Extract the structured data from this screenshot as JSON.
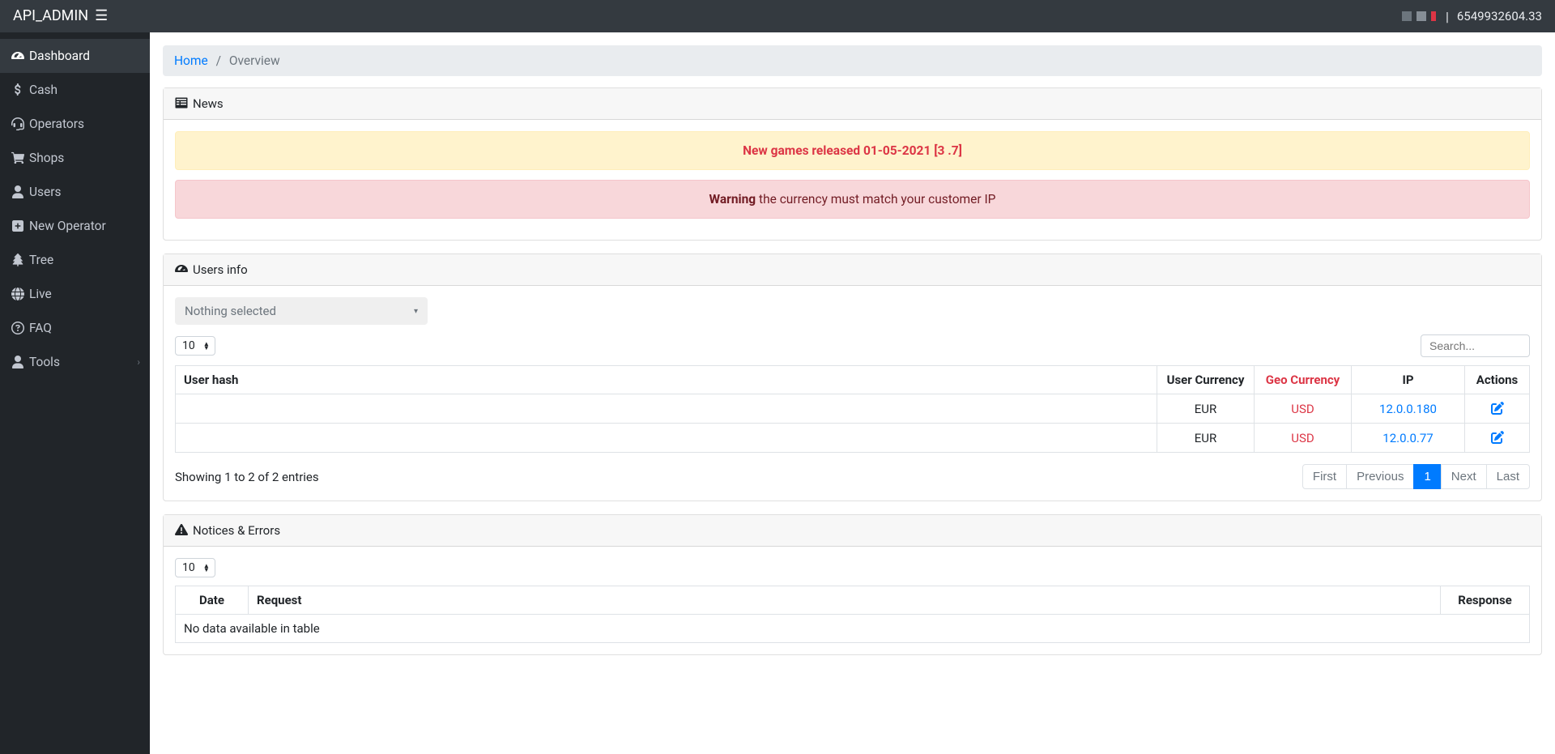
{
  "topbar": {
    "brand": "API_ADMIN",
    "balance": "6549932604.33"
  },
  "sidebar": {
    "items": [
      {
        "label": "Dashboard",
        "icon": "gauge"
      },
      {
        "label": "Cash",
        "icon": "dollar"
      },
      {
        "label": "Operators",
        "icon": "headset"
      },
      {
        "label": "Shops",
        "icon": "cart"
      },
      {
        "label": "Users",
        "icon": "user"
      },
      {
        "label": "New Operator",
        "icon": "plus-square"
      },
      {
        "label": "Tree",
        "icon": "tree"
      },
      {
        "label": "Live",
        "icon": "globe"
      },
      {
        "label": "FAQ",
        "icon": "question"
      },
      {
        "label": "Tools",
        "icon": "user"
      }
    ]
  },
  "breadcrumb": {
    "home": "Home",
    "current": "Overview"
  },
  "news": {
    "header": "News",
    "release_text": "New games released 01-05-2021 [3 .7]",
    "warning_bold": "Warning",
    "warning_rest": " the currency must match your customer IP"
  },
  "users_info": {
    "header": "Users info",
    "dropdown_placeholder": "Nothing selected",
    "length_value": "10",
    "search_placeholder": "Search...",
    "columns": {
      "user_hash": "User hash",
      "user_currency": "User Currency",
      "geo_currency": "Geo Currency",
      "ip": "IP",
      "actions": "Actions"
    },
    "rows": [
      {
        "hash": "",
        "user_currency": "EUR",
        "geo_currency": "USD",
        "ip": "12.0.0.180"
      },
      {
        "hash": "",
        "user_currency": "EUR",
        "geo_currency": "USD",
        "ip": "12.0.0.77"
      }
    ],
    "showing_text": "Showing 1 to 2 of 2 entries",
    "pagination": {
      "first": "First",
      "previous": "Previous",
      "page1": "1",
      "next": "Next",
      "last": "Last"
    }
  },
  "notices": {
    "header": "Notices & Errors",
    "length_value": "10",
    "columns": {
      "date": "Date",
      "request": "Request",
      "response": "Response"
    },
    "empty_text": "No data available in table"
  }
}
